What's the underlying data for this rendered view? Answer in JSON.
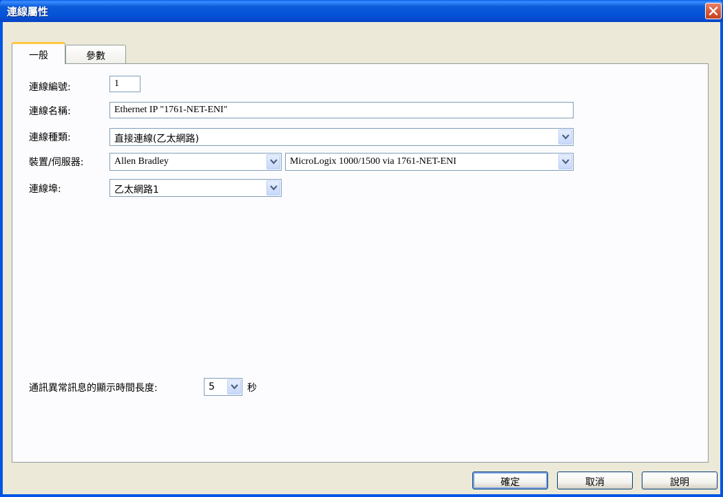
{
  "window": {
    "title": "連線屬性"
  },
  "tabs": [
    {
      "label": "一般",
      "active": true
    },
    {
      "label": "參數",
      "active": false
    }
  ],
  "form": {
    "connection_number": {
      "label": "連線編號:",
      "value": "1"
    },
    "connection_name": {
      "label": "連線名稱:",
      "value": "Ethernet IP \"1761-NET-ENI\""
    },
    "connection_type": {
      "label": "連線種類:",
      "value": "直接連線(乙太網路)"
    },
    "device_server": {
      "label": "裝置/伺服器:",
      "vendor": "Allen Bradley",
      "model": "MicroLogix 1000/1500 via 1761-NET-ENI"
    },
    "connection_port": {
      "label": "連線埠:",
      "value": "乙太網路1"
    },
    "error_display": {
      "label": "通訊異常訊息的顯示時間長度:",
      "value": "5",
      "unit": "秒"
    }
  },
  "buttons": {
    "ok": "確定",
    "cancel": "取消",
    "help": "說明"
  },
  "colors": {
    "titlebar": "#0452d8",
    "window_bg": "#ece9d8",
    "panel_bg": "#fcfcfe",
    "tab_highlight": "#ffc83c",
    "close_button": "#d85a3c"
  }
}
